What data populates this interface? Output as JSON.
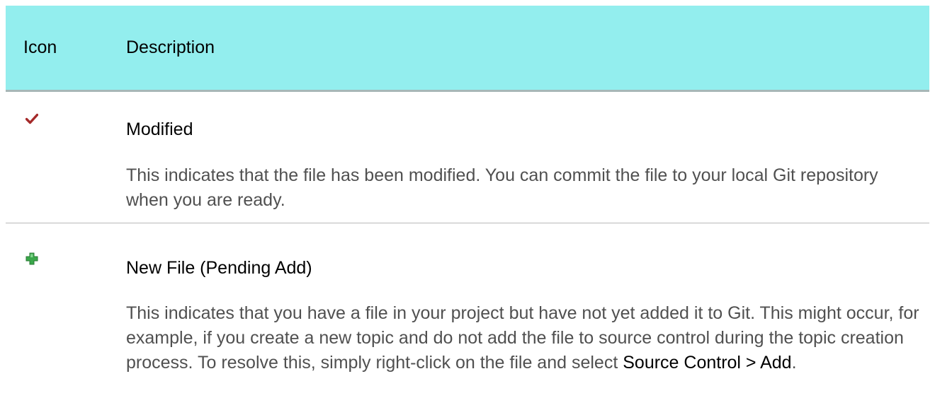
{
  "table": {
    "header": {
      "icon_col": "Icon",
      "desc_col": "Description"
    },
    "rows": [
      {
        "icon": "checkmark-icon",
        "icon_color": "#a52a2a",
        "title": "Modified",
        "body": "This indicates that the file has been modified. You can commit the file to your local Git repository when you are ready."
      },
      {
        "icon": "plus-icon",
        "icon_color": "#3aa84a",
        "title": "New File (Pending Add)",
        "body_before": "This indicates that you have a file in your project but have not yet added it to Git. This might occur, for example, if you create a new topic and do not add the file to source control during the topic creation process. To resolve this, simply right-click on the file and select ",
        "body_emph": "Source Control > Add",
        "body_after": "."
      }
    ]
  },
  "colors": {
    "header_bg": "#93eeee",
    "body_text": "#505050"
  }
}
